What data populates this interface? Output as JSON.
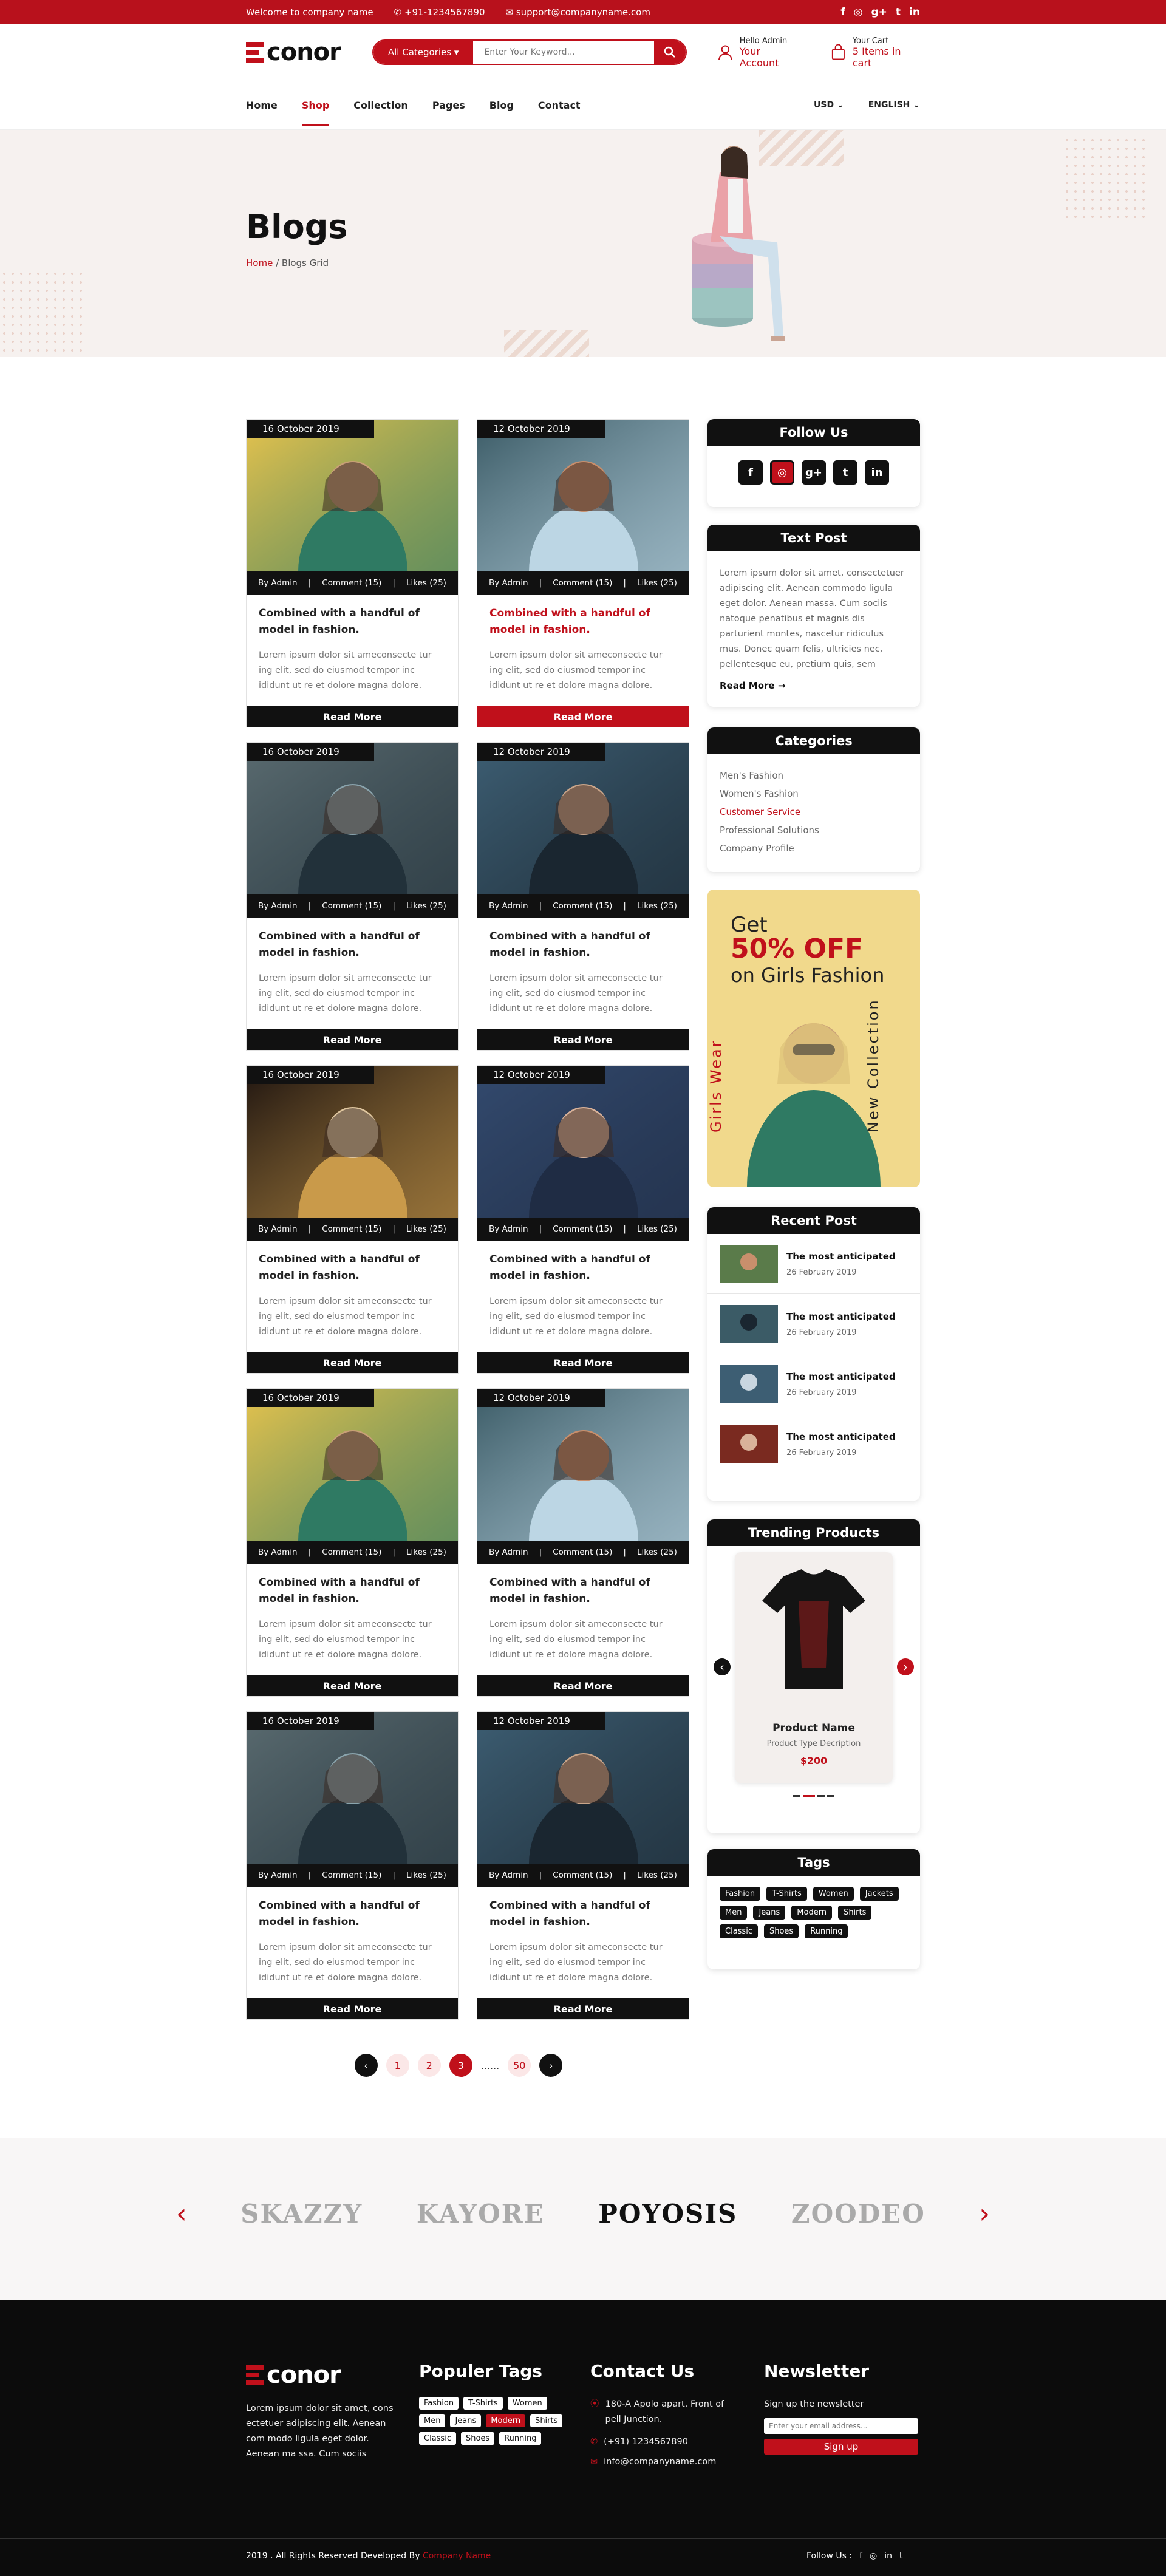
{
  "topbar": {
    "welcome": "Welcome to company name",
    "phone": "+91-1234567890",
    "email": "support@companyname.com",
    "social": [
      "f",
      "◎",
      "g+",
      "t",
      "in"
    ]
  },
  "header": {
    "logo": "conor",
    "search_category": "All Categories",
    "search_placeholder": "Enter Your Keyword...",
    "account_small": "Hello Admin",
    "account_big": "Your Account",
    "cart_small": "Your Cart",
    "cart_big": "5 Items in cart"
  },
  "nav": {
    "items": [
      "Home",
      "Shop",
      "Collection",
      "Pages",
      "Blog",
      "Contact"
    ],
    "currency": "USD",
    "language": "ENGLISH"
  },
  "hero": {
    "title": "Blogs",
    "crumb_home": "Home",
    "crumb_current": "/ Blogs Grid"
  },
  "posts": [
    {
      "date": "16 October 2019",
      "by": "By Admin",
      "comments": "Comment (15)",
      "likes": "Likes (25)",
      "title": "Combined with a handful of model in fashion.",
      "excerpt": "Lorem ipsum dolor sit ameconsecte tur ing elit, sed do eiusmod tempor inc ididunt ut re et dolore magna dolore.",
      "more": "Read More"
    },
    {
      "date": "12 October 2019",
      "by": "By Admin",
      "comments": "Comment (15)",
      "likes": "Likes (25)",
      "title": "Combined with a handful of model in fashion.",
      "excerpt": "Lorem ipsum dolor sit ameconsecte tur ing elit, sed do eiusmod tempor inc ididunt ut re et dolore magna dolore.",
      "more": "Read More"
    },
    {
      "date": "16 October 2019",
      "by": "By Admin",
      "comments": "Comment (15)",
      "likes": "Likes (25)",
      "title": "Combined with a handful of model in fashion.",
      "excerpt": "Lorem ipsum dolor sit ameconsecte tur ing elit, sed do eiusmod tempor inc ididunt ut re et dolore magna dolore.",
      "more": "Read More"
    },
    {
      "date": "12 October 2019",
      "by": "By Admin",
      "comments": "Comment (15)",
      "likes": "Likes (25)",
      "title": "Combined with a handful of model in fashion.",
      "excerpt": "Lorem ipsum dolor sit ameconsecte tur ing elit, sed do eiusmod tempor inc ididunt ut re et dolore magna dolore.",
      "more": "Read More"
    },
    {
      "date": "16 October 2019",
      "by": "By Admin",
      "comments": "Comment (15)",
      "likes": "Likes (25)",
      "title": "Combined with a handful of model in fashion.",
      "excerpt": "Lorem ipsum dolor sit ameconsecte tur ing elit, sed do eiusmod tempor inc ididunt ut re et dolore magna dolore.",
      "more": "Read More"
    },
    {
      "date": "12 October 2019",
      "by": "By Admin",
      "comments": "Comment (15)",
      "likes": "Likes (25)",
      "title": "Combined with a handful of model in fashion.",
      "excerpt": "Lorem ipsum dolor sit ameconsecte tur ing elit, sed do eiusmod tempor inc ididunt ut re et dolore magna dolore.",
      "more": "Read More"
    },
    {
      "date": "16 October 2019",
      "by": "By Admin",
      "comments": "Comment (15)",
      "likes": "Likes (25)",
      "title": "Combined with a handful of model in fashion.",
      "excerpt": "Lorem ipsum dolor sit ameconsecte tur ing elit, sed do eiusmod tempor inc ididunt ut re et dolore magna dolore.",
      "more": "Read More"
    },
    {
      "date": "12 October 2019",
      "by": "By Admin",
      "comments": "Comment (15)",
      "likes": "Likes (25)",
      "title": "Combined with a handful of model in fashion.",
      "excerpt": "Lorem ipsum dolor sit ameconsecte tur ing elit, sed do eiusmod tempor inc ididunt ut re et dolore magna dolore.",
      "more": "Read More"
    },
    {
      "date": "16 October 2019",
      "by": "By Admin",
      "comments": "Comment (15)",
      "likes": "Likes (25)",
      "title": "Combined with a handful of model in fashion.",
      "excerpt": "Lorem ipsum dolor sit ameconsecte tur ing elit, sed do eiusmod tempor inc ididunt ut re et dolore magna dolore.",
      "more": "Read More"
    },
    {
      "date": "12 October 2019",
      "by": "By Admin",
      "comments": "Comment (15)",
      "likes": "Likes (25)",
      "title": "Combined with a handful of model in fashion.",
      "excerpt": "Lorem ipsum dolor sit ameconsecte tur ing elit, sed do eiusmod tempor inc ididunt ut re et dolore magna dolore.",
      "more": "Read More"
    }
  ],
  "sidebar": {
    "follow_title": "Follow Us",
    "follow_icons": [
      "f",
      "◎",
      "g+",
      "t",
      "in"
    ],
    "text_title": "Text Post",
    "text_body": "Lorem ipsum dolor sit amet, consectetuer adipiscing elit. Aenean commodo ligula eget dolor. Aenean massa. Cum sociis natoque penatibus et magnis dis parturient montes, nascetur ridiculus mus. Donec quam felis, ultricies nec, pellentesque eu, pretium quis, sem",
    "text_more": "Read More →",
    "cat_title": "Categories",
    "categories": [
      "Men's Fashion",
      "Women's Fashion",
      "Customer Service",
      "Professional Solutions",
      "Company Profile"
    ],
    "banner": {
      "line1": "Get",
      "line2": "50% OFF",
      "line3": "on Girls Fashion",
      "left": "Girls Wear",
      "right": "New Collection"
    },
    "recent_title": "Recent Post",
    "recent": [
      {
        "title": "The most anticipated",
        "date": "26 February 2019"
      },
      {
        "title": "The most anticipated",
        "date": "26 February 2019"
      },
      {
        "title": "The most anticipated",
        "date": "26 February 2019"
      },
      {
        "title": "The most anticipated",
        "date": "26 February 2019"
      }
    ],
    "trending_title": "Trending Products",
    "product": {
      "name": "Product Name",
      "desc": "Product Type Decription",
      "price": "$200"
    },
    "tags_title": "Tags",
    "tags": [
      "Fashion",
      "T-Shirts",
      "Women",
      "Jackets",
      "Men",
      "Jeans",
      "Modern",
      "Shirts",
      "Classic",
      "Shoes",
      "Running"
    ]
  },
  "pager": [
    "1",
    "2",
    "3",
    "......",
    "50"
  ],
  "brands": [
    "SKAZZY",
    "KAYORE",
    "POYOSIS",
    "ZOODEO"
  ],
  "footer": {
    "logo": "conor",
    "about": "Lorem ipsum dolor sit amet, cons ectetuer adipiscing elit. Aenean com modo ligula eget dolor. Aenean ma ssa. Cum sociis",
    "tags_title": "Populer Tags",
    "tags": [
      "Fashion",
      "T-Shirts",
      "Women",
      "Men",
      "Jeans",
      "Modern",
      "Shirts",
      "Classic",
      "Shoes",
      "Running"
    ],
    "contact_title": "Contact Us",
    "address": "180-A Apolo apart. Front of pell Junction.",
    "phone": "(+91) 1234567890",
    "email": "info@companyname.com",
    "news_title": "Newsletter",
    "news_text": "Sign up the newsletter",
    "news_placeholder": "Enter your email address...",
    "news_btn": "Sign up",
    "copyright": "2019 . All Rights Reserved Developed By",
    "company": "Company Name",
    "follow": "Follow Us :"
  },
  "colors": {
    "accent": "#c0101b",
    "dark": "#111111"
  }
}
